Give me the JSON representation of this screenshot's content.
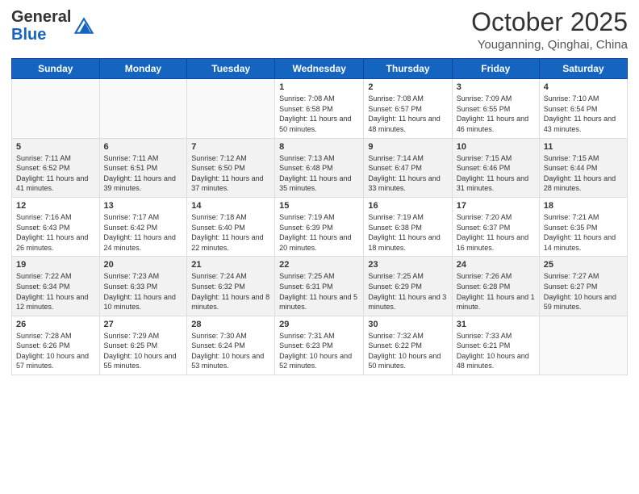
{
  "header": {
    "logo_general": "General",
    "logo_blue": "Blue",
    "month": "October 2025",
    "location": "Youganning, Qinghai, China"
  },
  "weekdays": [
    "Sunday",
    "Monday",
    "Tuesday",
    "Wednesday",
    "Thursday",
    "Friday",
    "Saturday"
  ],
  "rows": [
    [
      {
        "day": "",
        "sunrise": "",
        "sunset": "",
        "daylight": ""
      },
      {
        "day": "",
        "sunrise": "",
        "sunset": "",
        "daylight": ""
      },
      {
        "day": "",
        "sunrise": "",
        "sunset": "",
        "daylight": ""
      },
      {
        "day": "1",
        "sunrise": "Sunrise: 7:08 AM",
        "sunset": "Sunset: 6:58 PM",
        "daylight": "Daylight: 11 hours and 50 minutes."
      },
      {
        "day": "2",
        "sunrise": "Sunrise: 7:08 AM",
        "sunset": "Sunset: 6:57 PM",
        "daylight": "Daylight: 11 hours and 48 minutes."
      },
      {
        "day": "3",
        "sunrise": "Sunrise: 7:09 AM",
        "sunset": "Sunset: 6:55 PM",
        "daylight": "Daylight: 11 hours and 46 minutes."
      },
      {
        "day": "4",
        "sunrise": "Sunrise: 7:10 AM",
        "sunset": "Sunset: 6:54 PM",
        "daylight": "Daylight: 11 hours and 43 minutes."
      }
    ],
    [
      {
        "day": "5",
        "sunrise": "Sunrise: 7:11 AM",
        "sunset": "Sunset: 6:52 PM",
        "daylight": "Daylight: 11 hours and 41 minutes."
      },
      {
        "day": "6",
        "sunrise": "Sunrise: 7:11 AM",
        "sunset": "Sunset: 6:51 PM",
        "daylight": "Daylight: 11 hours and 39 minutes."
      },
      {
        "day": "7",
        "sunrise": "Sunrise: 7:12 AM",
        "sunset": "Sunset: 6:50 PM",
        "daylight": "Daylight: 11 hours and 37 minutes."
      },
      {
        "day": "8",
        "sunrise": "Sunrise: 7:13 AM",
        "sunset": "Sunset: 6:48 PM",
        "daylight": "Daylight: 11 hours and 35 minutes."
      },
      {
        "day": "9",
        "sunrise": "Sunrise: 7:14 AM",
        "sunset": "Sunset: 6:47 PM",
        "daylight": "Daylight: 11 hours and 33 minutes."
      },
      {
        "day": "10",
        "sunrise": "Sunrise: 7:15 AM",
        "sunset": "Sunset: 6:46 PM",
        "daylight": "Daylight: 11 hours and 31 minutes."
      },
      {
        "day": "11",
        "sunrise": "Sunrise: 7:15 AM",
        "sunset": "Sunset: 6:44 PM",
        "daylight": "Daylight: 11 hours and 28 minutes."
      }
    ],
    [
      {
        "day": "12",
        "sunrise": "Sunrise: 7:16 AM",
        "sunset": "Sunset: 6:43 PM",
        "daylight": "Daylight: 11 hours and 26 minutes."
      },
      {
        "day": "13",
        "sunrise": "Sunrise: 7:17 AM",
        "sunset": "Sunset: 6:42 PM",
        "daylight": "Daylight: 11 hours and 24 minutes."
      },
      {
        "day": "14",
        "sunrise": "Sunrise: 7:18 AM",
        "sunset": "Sunset: 6:40 PM",
        "daylight": "Daylight: 11 hours and 22 minutes."
      },
      {
        "day": "15",
        "sunrise": "Sunrise: 7:19 AM",
        "sunset": "Sunset: 6:39 PM",
        "daylight": "Daylight: 11 hours and 20 minutes."
      },
      {
        "day": "16",
        "sunrise": "Sunrise: 7:19 AM",
        "sunset": "Sunset: 6:38 PM",
        "daylight": "Daylight: 11 hours and 18 minutes."
      },
      {
        "day": "17",
        "sunrise": "Sunrise: 7:20 AM",
        "sunset": "Sunset: 6:37 PM",
        "daylight": "Daylight: 11 hours and 16 minutes."
      },
      {
        "day": "18",
        "sunrise": "Sunrise: 7:21 AM",
        "sunset": "Sunset: 6:35 PM",
        "daylight": "Daylight: 11 hours and 14 minutes."
      }
    ],
    [
      {
        "day": "19",
        "sunrise": "Sunrise: 7:22 AM",
        "sunset": "Sunset: 6:34 PM",
        "daylight": "Daylight: 11 hours and 12 minutes."
      },
      {
        "day": "20",
        "sunrise": "Sunrise: 7:23 AM",
        "sunset": "Sunset: 6:33 PM",
        "daylight": "Daylight: 11 hours and 10 minutes."
      },
      {
        "day": "21",
        "sunrise": "Sunrise: 7:24 AM",
        "sunset": "Sunset: 6:32 PM",
        "daylight": "Daylight: 11 hours and 8 minutes."
      },
      {
        "day": "22",
        "sunrise": "Sunrise: 7:25 AM",
        "sunset": "Sunset: 6:31 PM",
        "daylight": "Daylight: 11 hours and 5 minutes."
      },
      {
        "day": "23",
        "sunrise": "Sunrise: 7:25 AM",
        "sunset": "Sunset: 6:29 PM",
        "daylight": "Daylight: 11 hours and 3 minutes."
      },
      {
        "day": "24",
        "sunrise": "Sunrise: 7:26 AM",
        "sunset": "Sunset: 6:28 PM",
        "daylight": "Daylight: 11 hours and 1 minute."
      },
      {
        "day": "25",
        "sunrise": "Sunrise: 7:27 AM",
        "sunset": "Sunset: 6:27 PM",
        "daylight": "Daylight: 10 hours and 59 minutes."
      }
    ],
    [
      {
        "day": "26",
        "sunrise": "Sunrise: 7:28 AM",
        "sunset": "Sunset: 6:26 PM",
        "daylight": "Daylight: 10 hours and 57 minutes."
      },
      {
        "day": "27",
        "sunrise": "Sunrise: 7:29 AM",
        "sunset": "Sunset: 6:25 PM",
        "daylight": "Daylight: 10 hours and 55 minutes."
      },
      {
        "day": "28",
        "sunrise": "Sunrise: 7:30 AM",
        "sunset": "Sunset: 6:24 PM",
        "daylight": "Daylight: 10 hours and 53 minutes."
      },
      {
        "day": "29",
        "sunrise": "Sunrise: 7:31 AM",
        "sunset": "Sunset: 6:23 PM",
        "daylight": "Daylight: 10 hours and 52 minutes."
      },
      {
        "day": "30",
        "sunrise": "Sunrise: 7:32 AM",
        "sunset": "Sunset: 6:22 PM",
        "daylight": "Daylight: 10 hours and 50 minutes."
      },
      {
        "day": "31",
        "sunrise": "Sunrise: 7:33 AM",
        "sunset": "Sunset: 6:21 PM",
        "daylight": "Daylight: 10 hours and 48 minutes."
      },
      {
        "day": "",
        "sunrise": "",
        "sunset": "",
        "daylight": ""
      }
    ]
  ]
}
